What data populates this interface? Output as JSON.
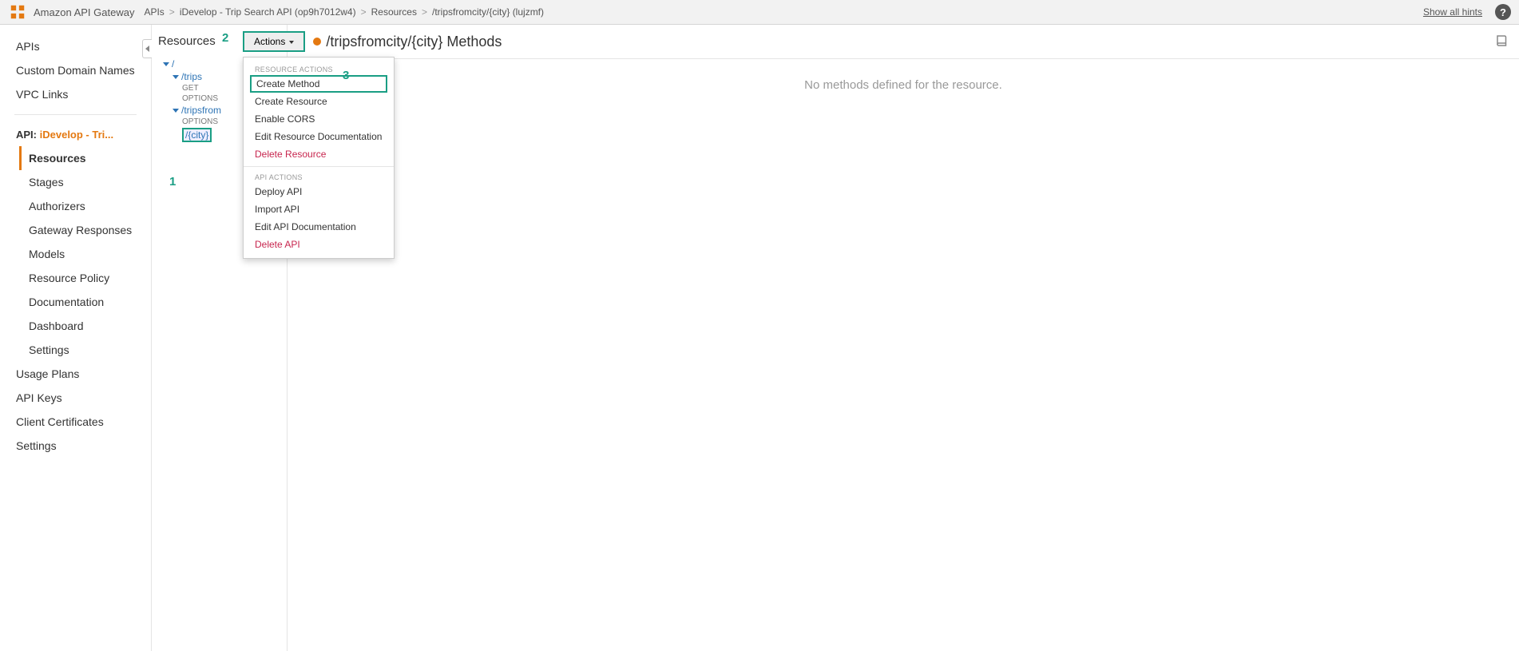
{
  "topbar": {
    "service": "Amazon API Gateway",
    "breadcrumbs": {
      "b0": "APIs",
      "b1": "iDevelop - Trip Search API (op9h7012w4)",
      "b2": "Resources",
      "b3": "/tripsfromcity/{city} (lujzmf)"
    },
    "hints": "Show all hints"
  },
  "left_nav": {
    "apis": "APIs",
    "custom_domain": "Custom Domain Names",
    "vpc_links": "VPC Links",
    "api_label_k": "API:",
    "api_label_v": "iDevelop - Tri...",
    "resources": "Resources",
    "stages": "Stages",
    "authorizers": "Authorizers",
    "gateway_responses": "Gateway Responses",
    "models": "Models",
    "resource_policy": "Resource Policy",
    "documentation": "Documentation",
    "dashboard": "Dashboard",
    "settings": "Settings",
    "usage_plans": "Usage Plans",
    "api_keys": "API Keys",
    "client_certs": "Client Certificates",
    "settings2": "Settings"
  },
  "resources": {
    "title": "Resources",
    "tree": {
      "root": "/",
      "trips": "/trips",
      "trips_get": "GET",
      "trips_options": "OPTIONS",
      "tripsfrom": "/tripsfrom",
      "tripsfrom_options": "OPTIONS",
      "city": "/{city}"
    }
  },
  "annotations": {
    "a1": "1",
    "a2": "2",
    "a3": "3"
  },
  "actions": {
    "button": "Actions",
    "section_resource": "RESOURCE ACTIONS",
    "create_method": "Create Method",
    "create_resource": "Create Resource",
    "enable_cors": "Enable CORS",
    "edit_resource_doc": "Edit Resource Documentation",
    "delete_resource": "Delete Resource",
    "section_api": "API ACTIONS",
    "deploy_api": "Deploy API",
    "import_api": "Import API",
    "edit_api_doc": "Edit API Documentation",
    "delete_api": "Delete API"
  },
  "content": {
    "title": "/tripsfromcity/{city} Methods",
    "empty": "No methods defined for the resource."
  }
}
